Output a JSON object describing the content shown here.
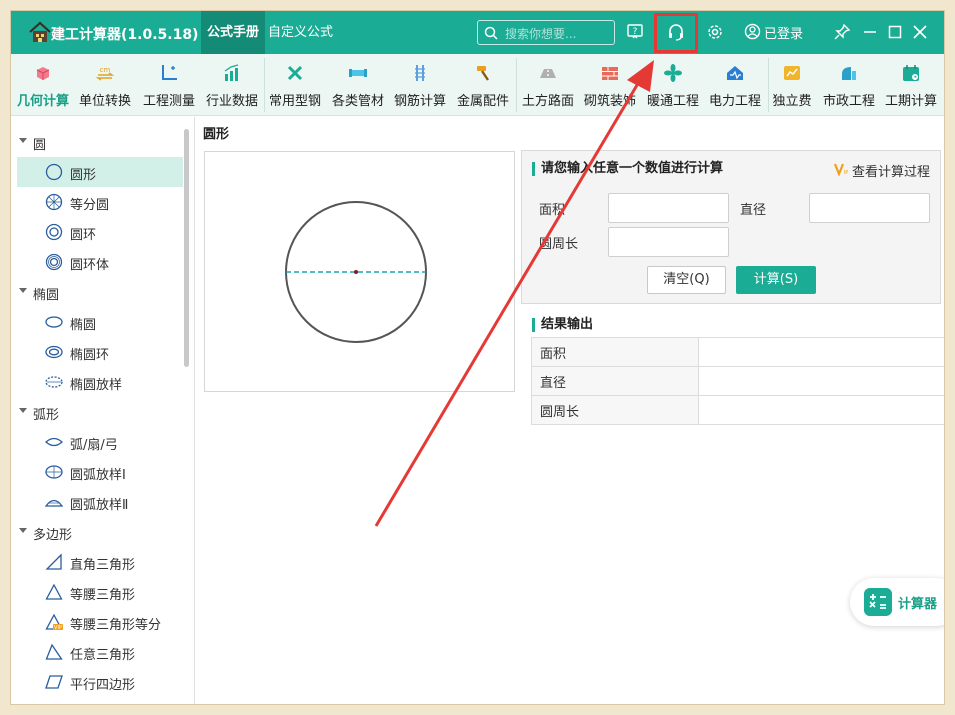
{
  "app": {
    "title": "建工计算器(1.0.5.18)",
    "logged_in_label": "已登录"
  },
  "header": {
    "tabs": [
      {
        "label": "公式手册",
        "active": true
      },
      {
        "label": "自定义公式",
        "active": false
      }
    ],
    "search_placeholder": "搜索你想要..."
  },
  "toolbar": {
    "items": [
      {
        "label": "几何计算",
        "icon": "cube-icon",
        "active": true
      },
      {
        "label": "单位转换",
        "icon": "unit-convert-icon"
      },
      {
        "label": "工程测量",
        "icon": "axis-measure-icon"
      },
      {
        "label": "行业数据",
        "icon": "bar-chart-icon"
      },
      {
        "label": "常用型钢",
        "icon": "tools-icon"
      },
      {
        "label": "各类管材",
        "icon": "pipe-icon"
      },
      {
        "label": "钢筋计算",
        "icon": "rebar-icon"
      },
      {
        "label": "金属配件",
        "icon": "hammer-icon"
      },
      {
        "label": "土方路面",
        "icon": "road-icon"
      },
      {
        "label": "砌筑装饰",
        "icon": "brick-wall-icon"
      },
      {
        "label": "暖通工程",
        "icon": "fan-icon"
      },
      {
        "label": "电力工程",
        "icon": "power-house-icon"
      },
      {
        "label": "独立费",
        "icon": "money-icon"
      },
      {
        "label": "市政工程",
        "icon": "municipal-icon"
      },
      {
        "label": "工期计算",
        "icon": "calendar-icon"
      }
    ]
  },
  "sidebar": {
    "groups": [
      {
        "label": "圆",
        "items": [
          "圆形",
          "等分圆",
          "圆环",
          "圆环体"
        ]
      },
      {
        "label": "椭圆",
        "items": [
          "椭圆",
          "椭圆环",
          "椭圆放样"
        ]
      },
      {
        "label": "弧形",
        "items": [
          "弧/扇/弓",
          "圆弧放样Ⅰ",
          "圆弧放样Ⅱ"
        ]
      },
      {
        "label": "多边形",
        "items": [
          "直角三角形",
          "等腰三角形",
          "等腰三角形等分",
          "任意三角形",
          "平行四边形"
        ]
      }
    ],
    "selected": "圆形"
  },
  "main": {
    "title": "圆形",
    "panel": {
      "heading": "请您输入任意一个数值进行计算",
      "view_process": "查看计算过程",
      "fields": [
        {
          "label": "面积",
          "value": ""
        },
        {
          "label": "直径",
          "value": ""
        },
        {
          "label": "圆周长",
          "value": ""
        }
      ],
      "clear_label": "清空(Q)",
      "calc_label": "计算(S)"
    },
    "results": {
      "heading": "结果输出",
      "rows": [
        {
          "label": "面积",
          "value": ""
        },
        {
          "label": "直径",
          "value": ""
        },
        {
          "label": "圆周长",
          "value": ""
        }
      ]
    }
  },
  "floating": {
    "label": "计算器"
  },
  "colors": {
    "brand": "#1aac94",
    "highlight": "#e53935"
  }
}
